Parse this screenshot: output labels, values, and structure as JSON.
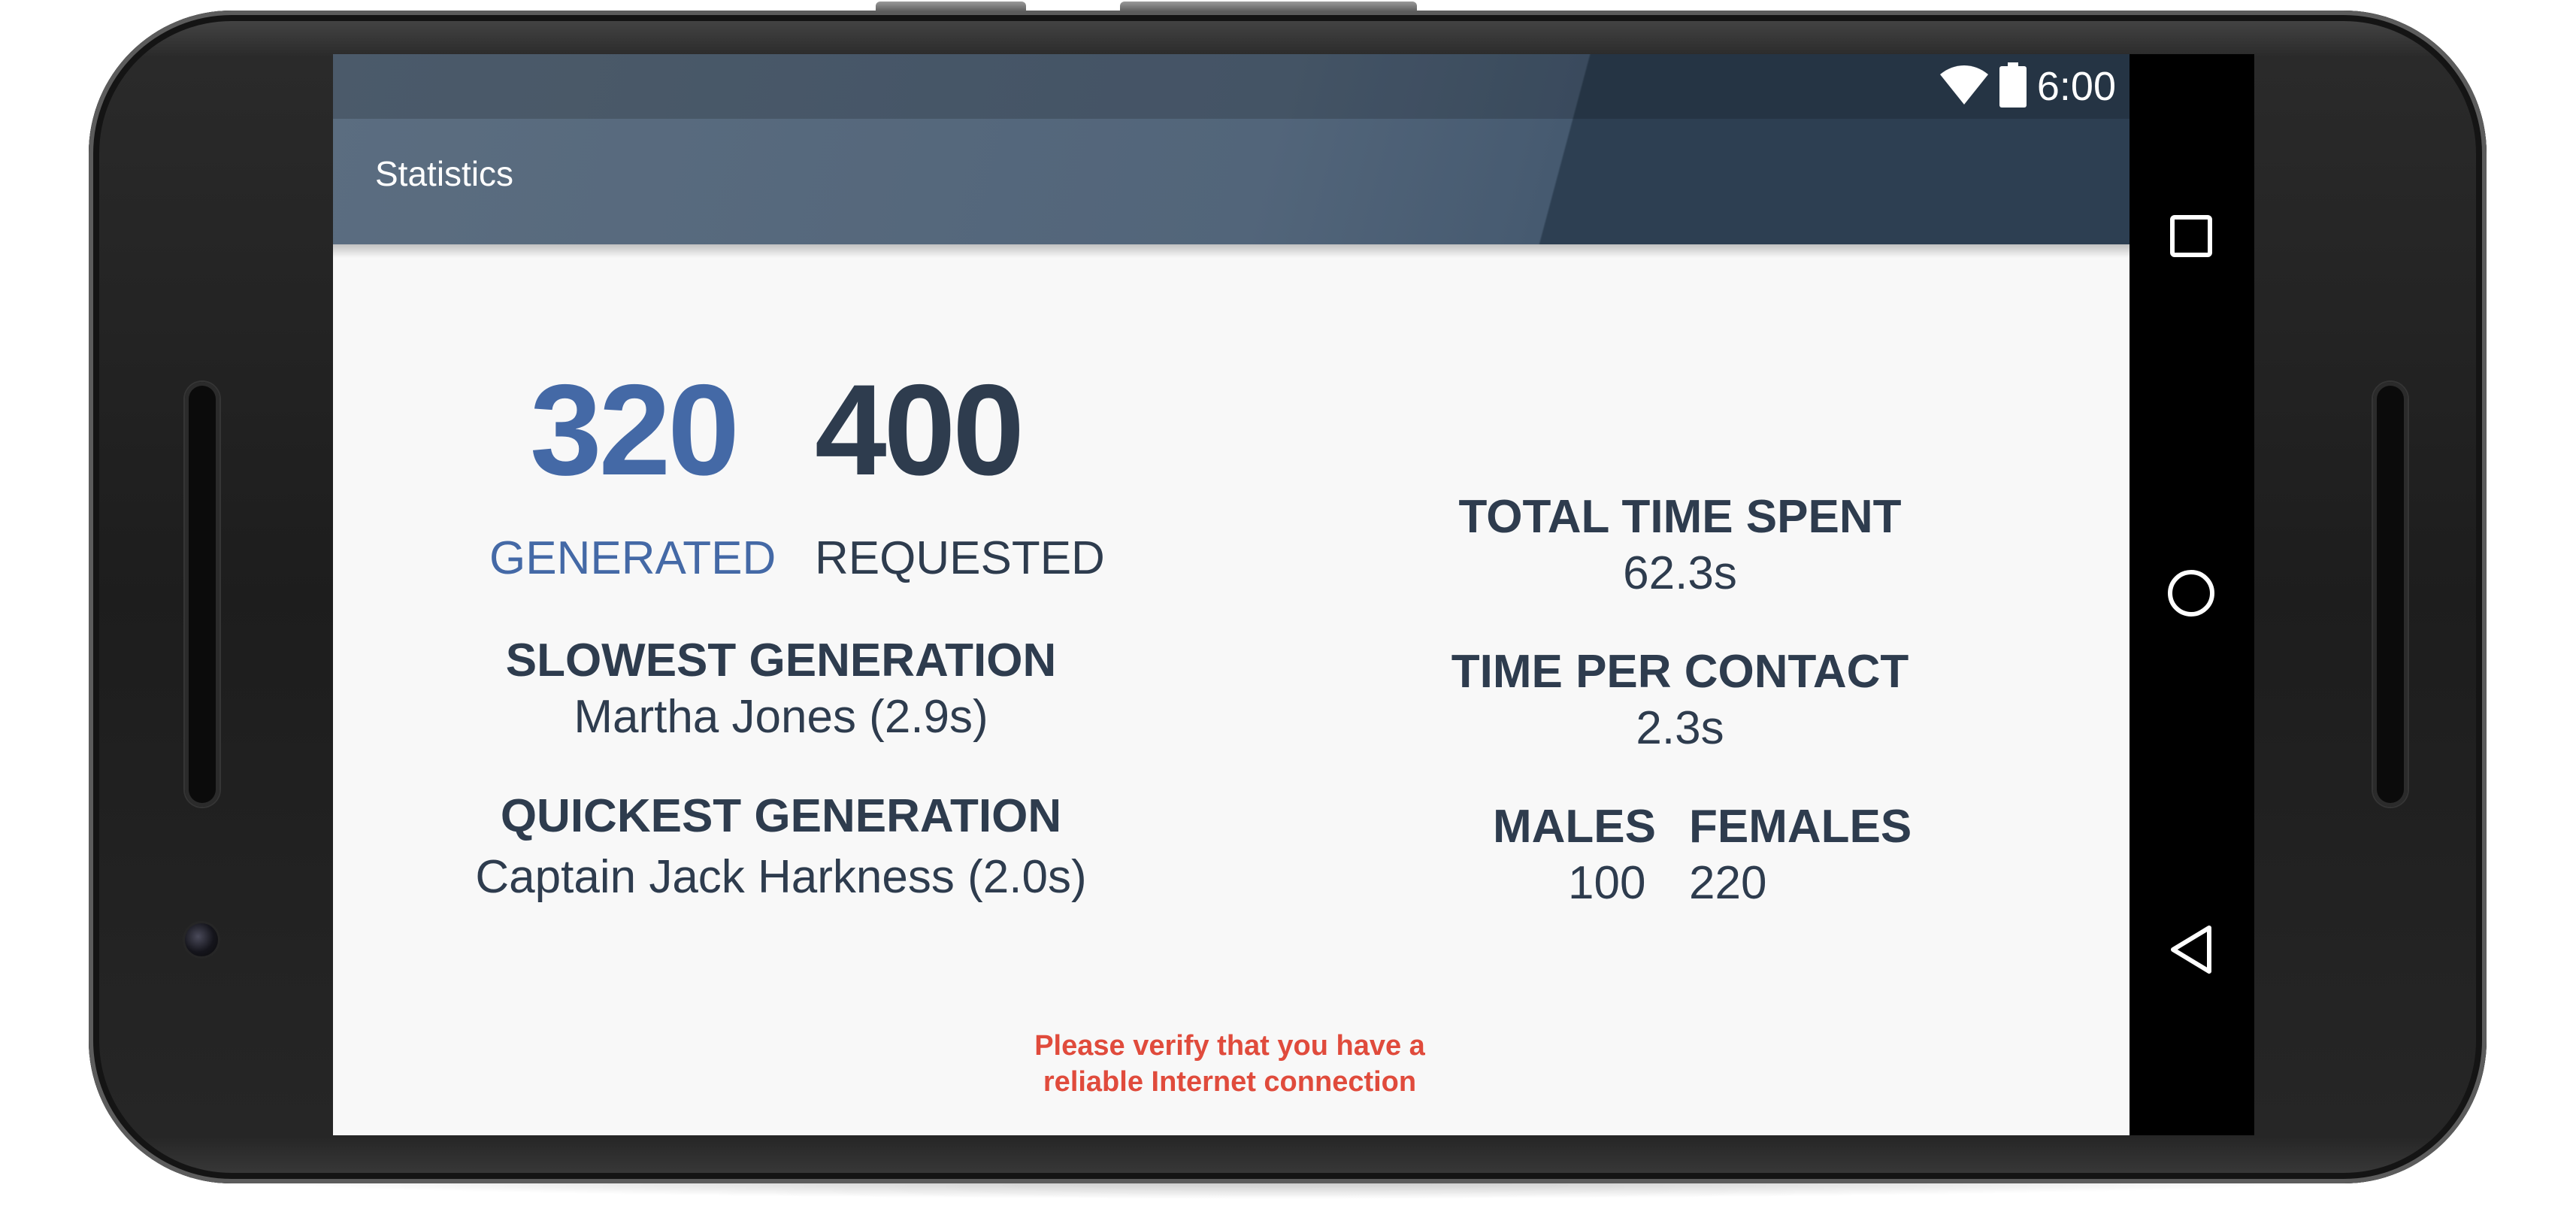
{
  "status_bar": {
    "time": "6:00",
    "icons": [
      "wifi-icon",
      "battery-icon"
    ]
  },
  "toolbar": {
    "title": "Statistics"
  },
  "stats": {
    "generated": {
      "value": "320",
      "label": "GENERATED"
    },
    "requested": {
      "value": "400",
      "label": "REQUESTED"
    },
    "slowest": {
      "heading": "SLOWEST GENERATION",
      "value": "Martha Jones (2.9s)"
    },
    "quickest": {
      "heading": "QUICKEST GENERATION",
      "value": "Captain Jack Harkness (2.0s)"
    },
    "total_time": {
      "heading": "TOTAL TIME SPENT",
      "value": "62.3s"
    },
    "time_per_contact": {
      "heading": "TIME PER CONTACT",
      "value": "2.3s"
    },
    "males": {
      "heading": "MALES",
      "value": "100"
    },
    "females": {
      "heading": "FEMALES",
      "value": "220"
    }
  },
  "warning": {
    "line1": "Please verify that you have a",
    "line2": "reliable Internet connection"
  },
  "nav_bar": {
    "buttons": [
      "recents-square-icon",
      "home-circle-icon",
      "back-triangle-icon"
    ]
  },
  "colors": {
    "app_bar": "#2d3f52",
    "accent_blue": "#4469a6",
    "dark_text": "#2e3c4e",
    "warning_red": "#e04b3c",
    "background": "#f8f8f8"
  }
}
